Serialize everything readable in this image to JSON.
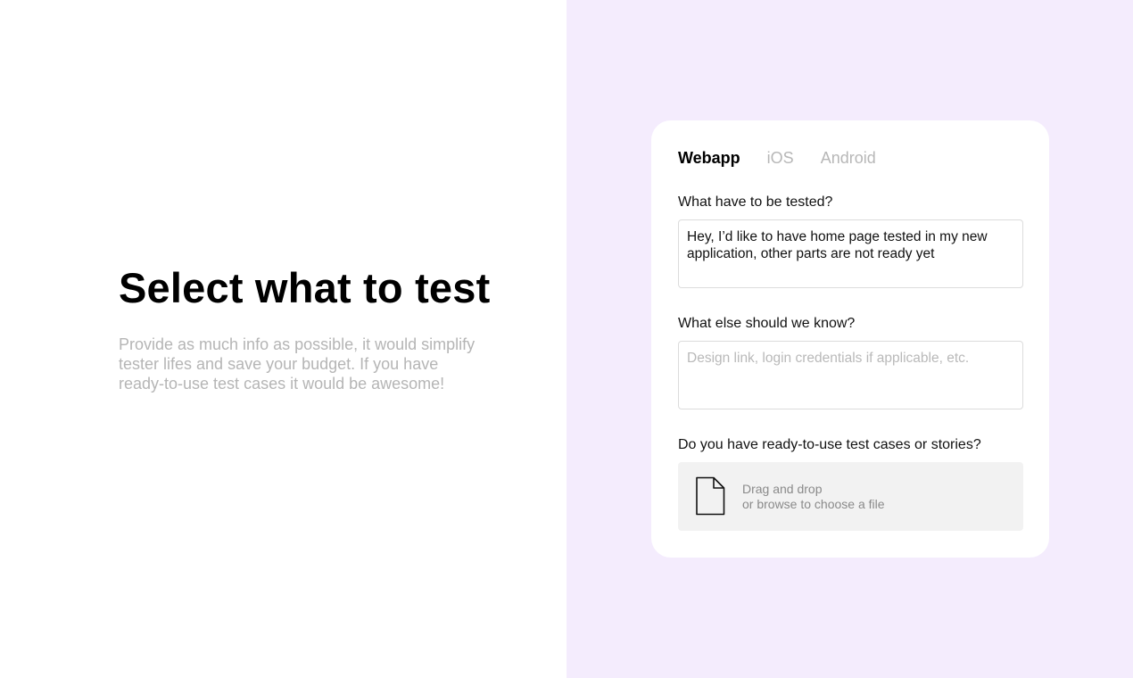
{
  "intro": {
    "title": "Select what to test",
    "description": "Provide as much info as possible, it would simplify tester lifes and save your budget. If you have ready-to-use test cases it would be awesome!"
  },
  "form": {
    "tabs": [
      {
        "label": "Webapp",
        "active": true
      },
      {
        "label": "iOS",
        "active": false
      },
      {
        "label": "Android",
        "active": false
      }
    ],
    "what_to_test": {
      "label": "What have to be tested?",
      "value": "Hey, I’d like to have home page tested in my new application, other parts are not ready yet"
    },
    "what_else": {
      "label": "What else should we know?",
      "placeholder": "Design link, login credentials if applicable, etc.",
      "value": ""
    },
    "test_cases": {
      "label": "Do you have ready-to-use test cases or stories?",
      "drop_line1": "Drag and drop",
      "drop_line2": "or browse to choose a file",
      "icon": "file-icon"
    }
  },
  "colors": {
    "right_panel_bg": "#f4ecfd",
    "card_bg": "#ffffff",
    "muted_text": "#b5b5b5",
    "dropzone_bg": "#f2f2f2"
  }
}
